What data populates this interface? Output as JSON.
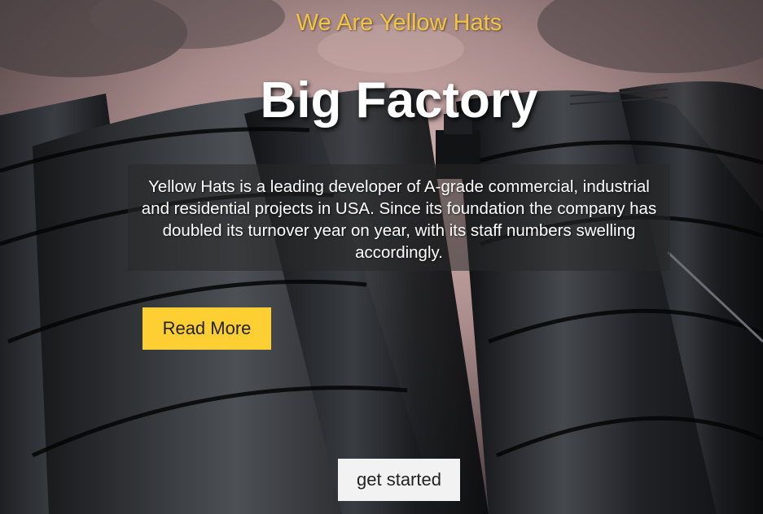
{
  "hero": {
    "tagline": "We Are Yellow Hats",
    "title": "Big Factory",
    "description": "Yellow Hats is a leading developer of A-grade commercial, industrial and residential projects in USA. Since its foundation the company has doubled its turnover year on year, with its staff numbers swelling accordingly.",
    "read_more_label": "Read More",
    "get_started_label": "get started"
  },
  "colors": {
    "accent_yellow": "#fecf33",
    "tagline_yellow": "#f2c53d",
    "button_light": "#f2f2f2",
    "overlay": "rgba(40,40,40,0.55)"
  }
}
